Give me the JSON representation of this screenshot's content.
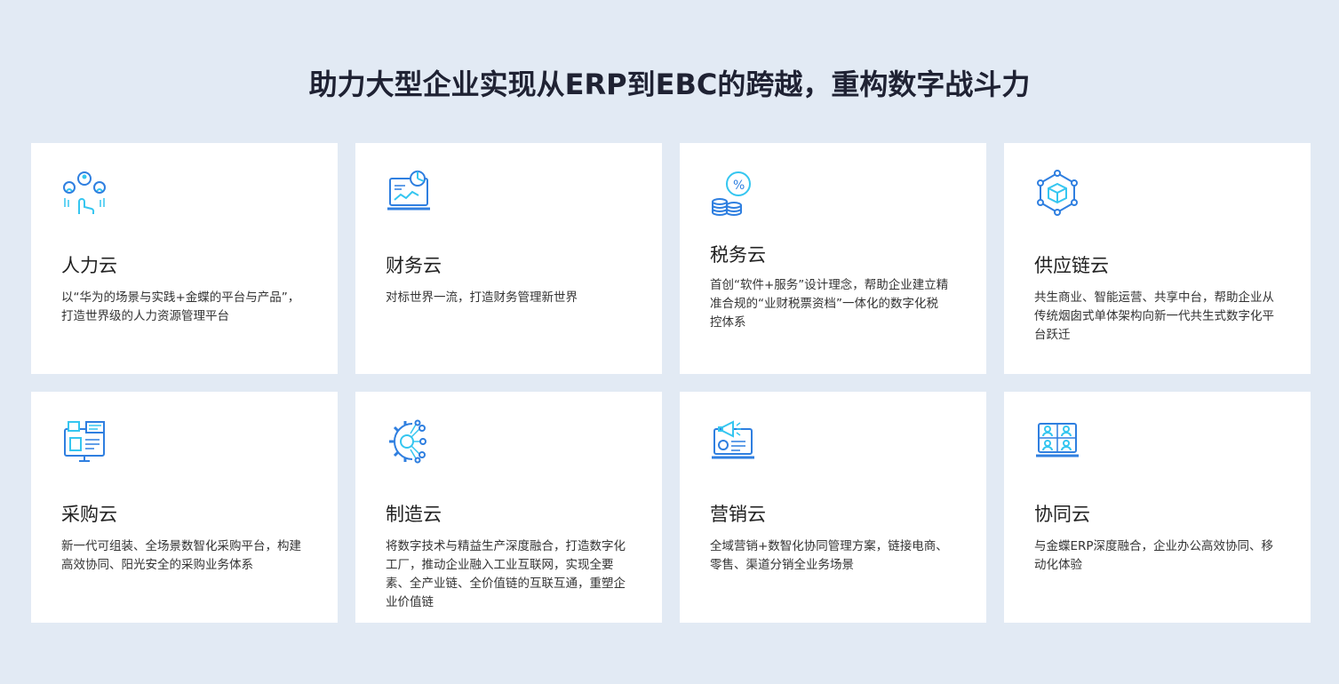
{
  "page": {
    "title": "助力大型企业实现从ERP到EBC的跨越，重构数字战斗力"
  },
  "colors": {
    "background": "#e2eaf4",
    "card": "#ffffff",
    "icon_primary": "#2f7fe0",
    "icon_accent": "#35c6f0"
  },
  "cards": [
    {
      "icon": "people-hand-icon",
      "title": "人力云",
      "desc": "以“华为的场景与实践+金蝶的平台与产品”，打造世界级的人力资源管理平台"
    },
    {
      "icon": "laptop-chart-icon",
      "title": "财务云",
      "desc": "对标世界一流，打造财务管理新世界"
    },
    {
      "icon": "coins-percent-icon",
      "title": "税务云",
      "desc": "首创“软件+服务”设计理念，帮助企业建立精准合规的“业财税票资档”一体化的数字化税控体系"
    },
    {
      "icon": "network-cube-icon",
      "title": "供应链云",
      "desc": "共生商业、智能运营、共享中台，帮助企业从传统烟囱式单体架构向新一代共生式数字化平台跃迁"
    },
    {
      "icon": "monitor-cart-icon",
      "title": "采购云",
      "desc": "新一代可组装、全场景数智化采购平台，构建高效协同、阳光安全的采购业务体系"
    },
    {
      "icon": "gear-network-icon",
      "title": "制造云",
      "desc": "将数字技术与精益生产深度融合，打造数字化工厂，推动企业融入工业互联网，实现全要素、全产业链、全价值链的互联互通，重塑企业价值链"
    },
    {
      "icon": "laptop-megaphone-icon",
      "title": "营销云",
      "desc": "全域营销+数智化协同管理方案，链接电商、零售、渠道分销全业务场景"
    },
    {
      "icon": "video-meeting-icon",
      "title": "协同云",
      "desc": "与金蝶ERP深度融合，企业办公高效协同、移动化体验"
    }
  ]
}
